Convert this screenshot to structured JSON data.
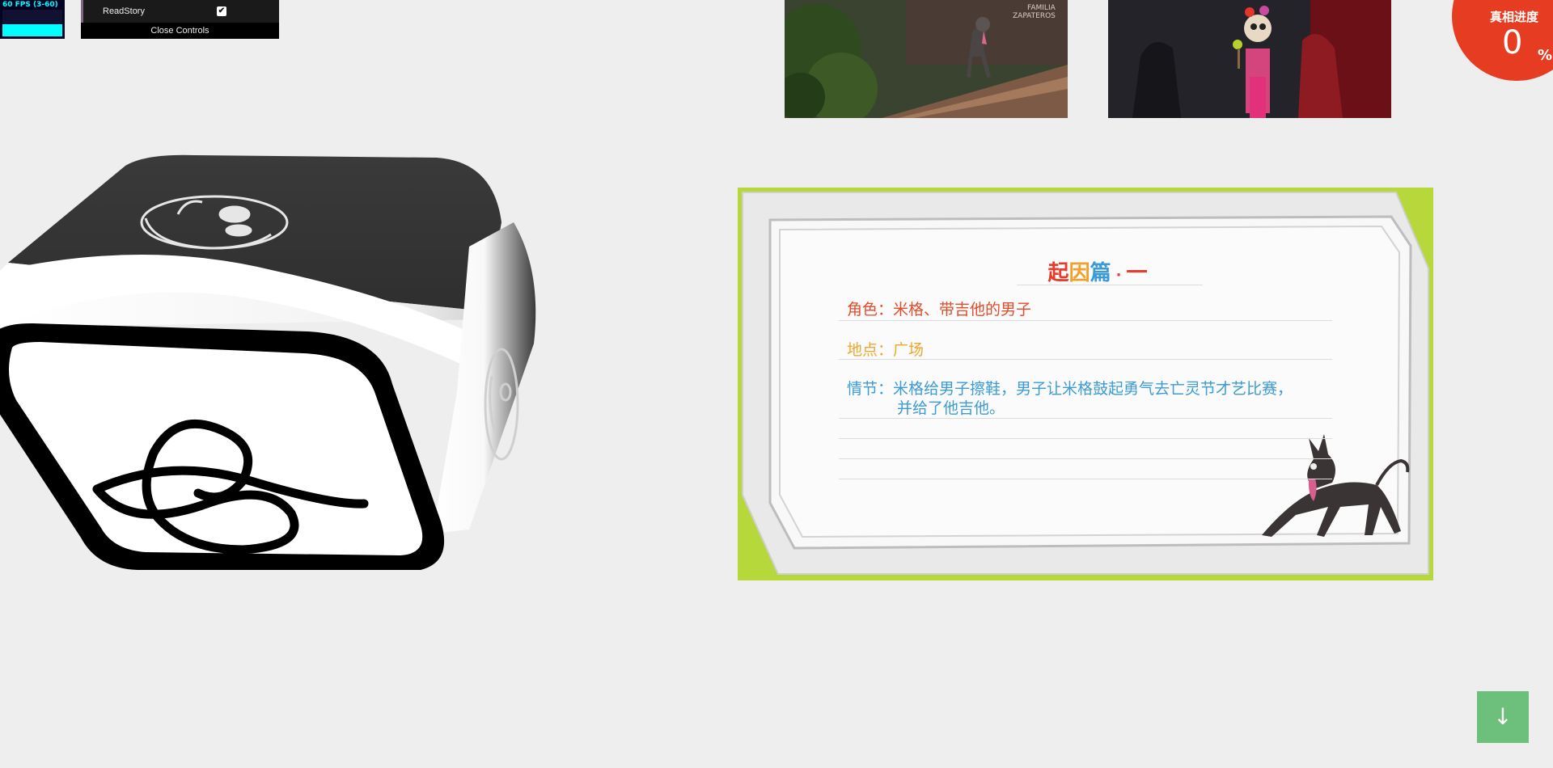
{
  "stats": {
    "fps_text": "60 FPS (3-60)",
    "fps_value": 60,
    "fps_min": 3,
    "fps_max": 60,
    "graph_color": "#00ffff"
  },
  "gui": {
    "controls": [
      {
        "label": "ReadStory",
        "checked": true
      }
    ],
    "close_label": "Close Controls",
    "accent": "#806787"
  },
  "thumbnails": [
    {
      "alt": "dog-scene",
      "lettering": [
        "FAMILIA",
        "ZAPATEROS"
      ]
    },
    {
      "alt": "frida-scene"
    }
  ],
  "progress": {
    "label": "真相进度",
    "value": "0",
    "unit": "%",
    "color": "#e63d22"
  },
  "dice": {
    "faces": [
      "treble-clef-icon",
      "character-head-icon",
      "character-head-side-icon"
    ],
    "colors": {
      "dark": "#333333",
      "light": "#ffffff"
    }
  },
  "story": {
    "title_parts": [
      "起",
      "因",
      "篇",
      "·",
      "一"
    ],
    "title_colors": [
      "#e73b2b",
      "#f0a12b",
      "#3b9bd6",
      "#e73b2b",
      "#e73b2b"
    ],
    "role": "角色：米格、带吉他的男子",
    "place": "地点：广场",
    "plot_line1": "情节：米格给男子擦鞋，男子让米格鼓起勇气去亡灵节才艺比赛，",
    "plot_line2": "并给了他吉他。",
    "frame_color": "#b6d83a"
  },
  "scroll_button": {
    "icon": "arrow-down-icon",
    "glyph": "↓",
    "color": "#6cc07b"
  }
}
